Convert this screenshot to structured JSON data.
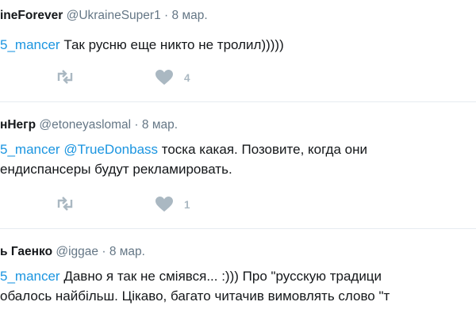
{
  "tweets": [
    {
      "name": "ineForever",
      "handle": "@UkraineSuper1",
      "dot": "·",
      "time": "8 мар.",
      "reply_to": "5_mancer",
      "text": " Так русню еще никто не тролил)))))",
      "likes": "4"
    },
    {
      "name": "нНегр",
      "handle": "@etoneyaslomal",
      "dot": "·",
      "time": "8 мар.",
      "reply_to": "5_mancer",
      "mention2": "@TrueDonbass",
      "text_line1": " тоска какая. Позовите, когда они",
      "text_line2": "ендиспансеры будут рекламировать.",
      "likes": "1"
    },
    {
      "name": "ь Гаенко",
      "handle": "@iggae",
      "dot": "·",
      "time": "8 мар.",
      "reply_to": "5_mancer",
      "text_line1": " Давно я так не сміявся... :))) Про \"русскую традици",
      "text_line2": "обалось найбільш. Цікаво, багато читачив вимовлять слово \"т"
    }
  ],
  "icons": {
    "retweet": "retweet-icon",
    "like": "heart-icon"
  },
  "colors": {
    "link": "#1b95e0",
    "meta": "#657786",
    "action": "#aab8c2",
    "divider": "#e6ecf0"
  }
}
